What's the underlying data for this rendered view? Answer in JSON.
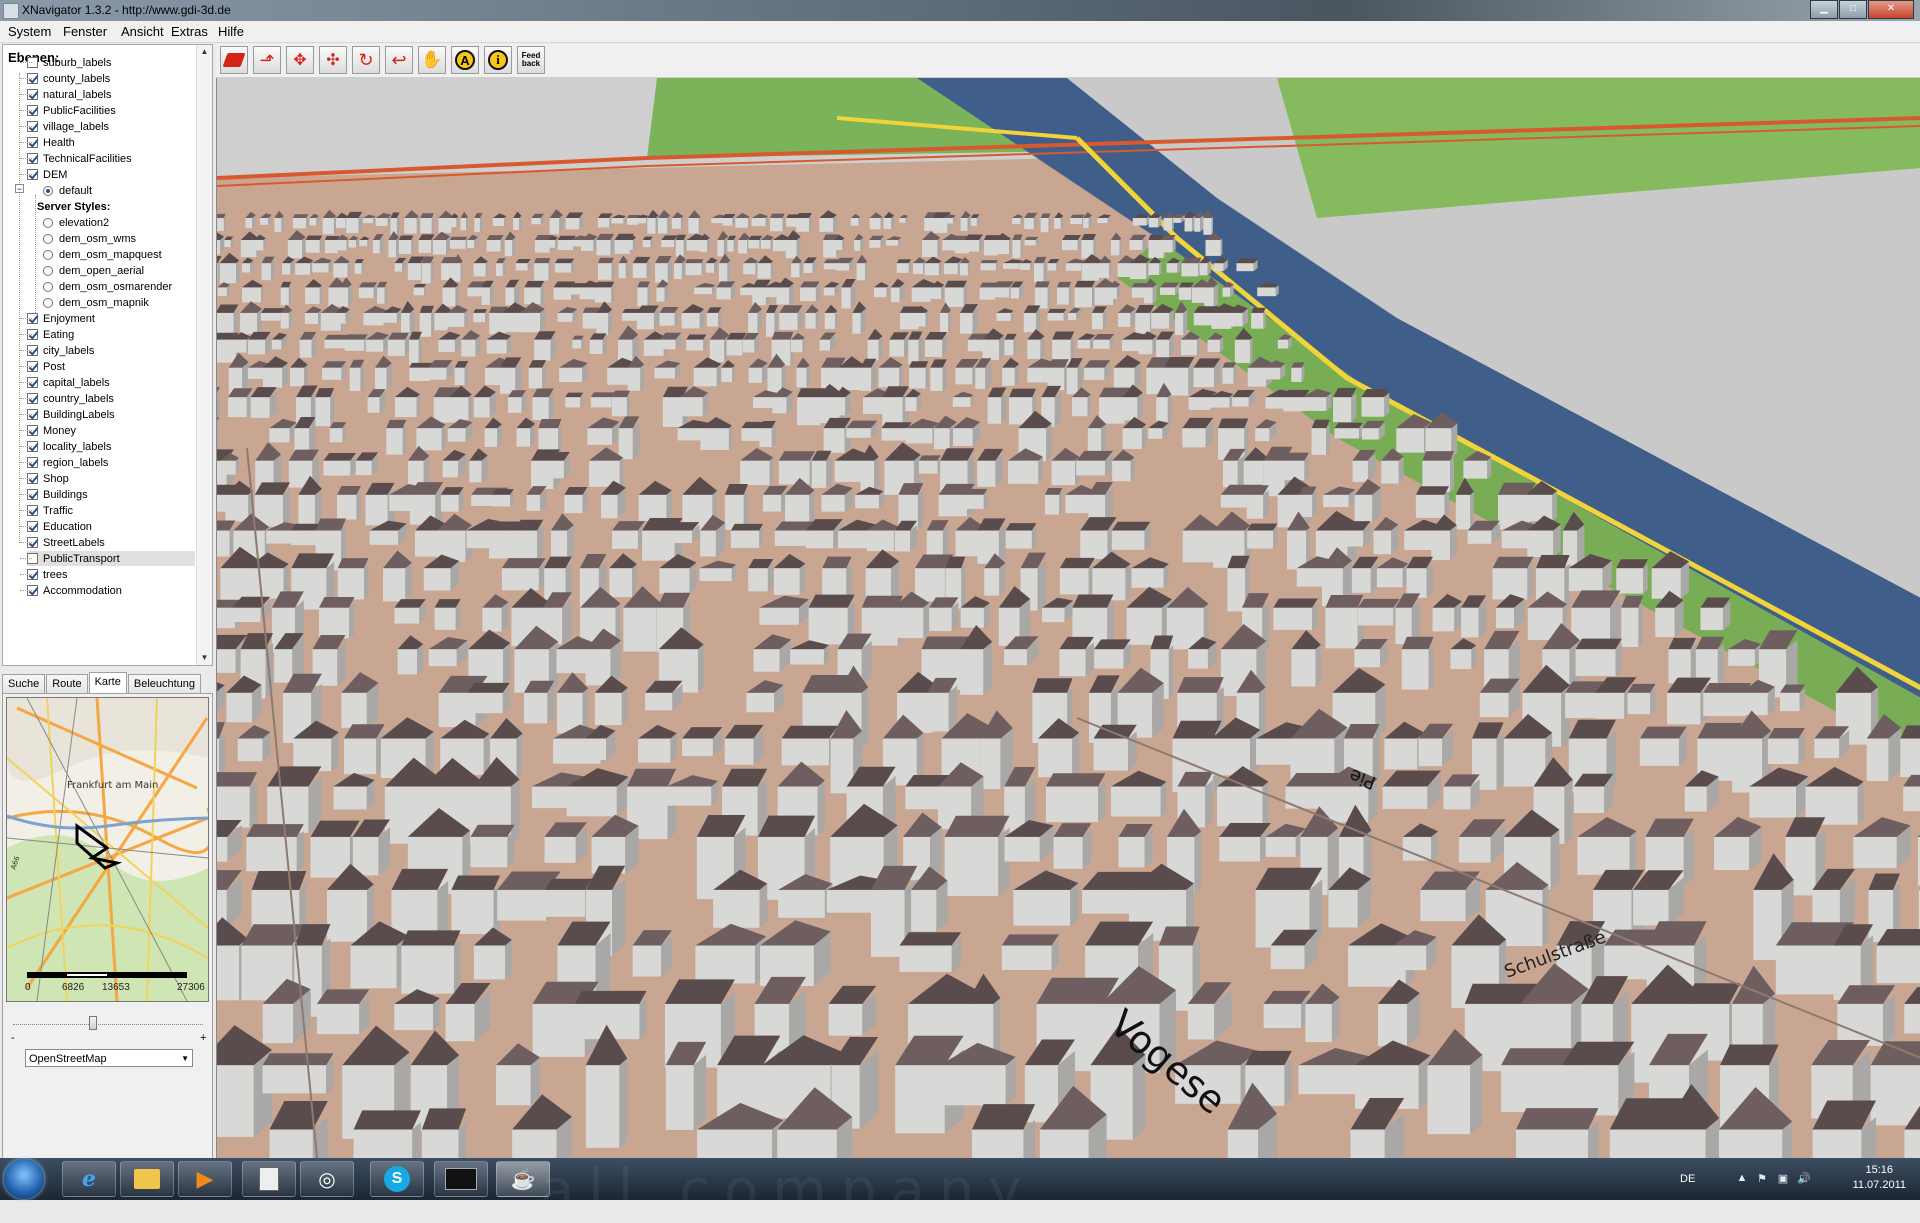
{
  "window": {
    "title": "XNavigator 1.3.2 - http://www.gdi-3d.de"
  },
  "menu": [
    "System",
    "Fenster",
    "Ansicht",
    "Extras",
    "Hilfe"
  ],
  "layers": {
    "heading": "Ebenen:",
    "items": [
      {
        "label": "suburb_labels",
        "checked": false
      },
      {
        "label": "county_labels",
        "checked": true
      },
      {
        "label": "natural_labels",
        "checked": true
      },
      {
        "label": "PublicFacilities",
        "checked": true
      },
      {
        "label": "village_labels",
        "checked": true
      },
      {
        "label": "Health",
        "checked": true
      },
      {
        "label": "TechnicalFacilities",
        "checked": true
      },
      {
        "label": "DEM",
        "checked": true
      },
      {
        "label": "default",
        "radio": true,
        "selected": true
      },
      {
        "label": "Server Styles:",
        "header": true
      },
      {
        "label": "elevation2",
        "radio": true
      },
      {
        "label": "dem_osm_wms",
        "radio": true
      },
      {
        "label": "dem_osm_mapquest",
        "radio": true
      },
      {
        "label": "dem_open_aerial",
        "radio": true
      },
      {
        "label": "dem_osm_osmarender",
        "radio": true
      },
      {
        "label": "dem_osm_mapnik",
        "radio": true
      },
      {
        "label": "Enjoyment",
        "checked": true
      },
      {
        "label": "Eating",
        "checked": true
      },
      {
        "label": "city_labels",
        "checked": true
      },
      {
        "label": "Post",
        "checked": true
      },
      {
        "label": "capital_labels",
        "checked": true
      },
      {
        "label": "country_labels",
        "checked": true
      },
      {
        "label": "BuildingLabels",
        "checked": true
      },
      {
        "label": "Money",
        "checked": true
      },
      {
        "label": "locality_labels",
        "checked": true
      },
      {
        "label": "region_labels",
        "checked": true
      },
      {
        "label": "Shop",
        "checked": true
      },
      {
        "label": "Buildings",
        "checked": true
      },
      {
        "label": "Traffic",
        "checked": true
      },
      {
        "label": "Education",
        "checked": true
      },
      {
        "label": "StreetLabels",
        "checked": true
      },
      {
        "label": "PublicTransport",
        "checked": false,
        "highlighted": true
      },
      {
        "label": "trees",
        "checked": true
      },
      {
        "label": "Accommodation",
        "checked": true
      }
    ]
  },
  "tabs": [
    "Suche",
    "Route",
    "Karte",
    "Beleuchtung"
  ],
  "active_tab": "Karte",
  "minimap": {
    "city_label": "Frankfurt am Main",
    "road_label": "A66",
    "scale": [
      "0",
      "6826",
      "13653",
      "27306"
    ]
  },
  "zoom": {
    "minus": "-",
    "plus": "+"
  },
  "map_source": "OpenStreetMap",
  "toolbar": {
    "buttons": [
      "pan-red",
      "tilt-red",
      "move-red",
      "move-red-2",
      "rotate-red",
      "undo-red",
      "hand",
      "A",
      "i"
    ],
    "feedback": "Feed\nback",
    "feedback_line1": "Feed",
    "feedback_line2": "back"
  },
  "street_labels": {
    "vogese": "Vogese",
    "pie": "Pie",
    "side_a": "Schulstraße"
  },
  "taskbar": {
    "watermark": "all company",
    "lang": "DE",
    "time": "15:16",
    "date": "11.07.2011"
  },
  "colors": {
    "ground": "#caa692",
    "roof": "#6e5e5f",
    "wall": "#d8d8d6",
    "river": "#3f5e8a",
    "grass": "#7fb35a"
  }
}
